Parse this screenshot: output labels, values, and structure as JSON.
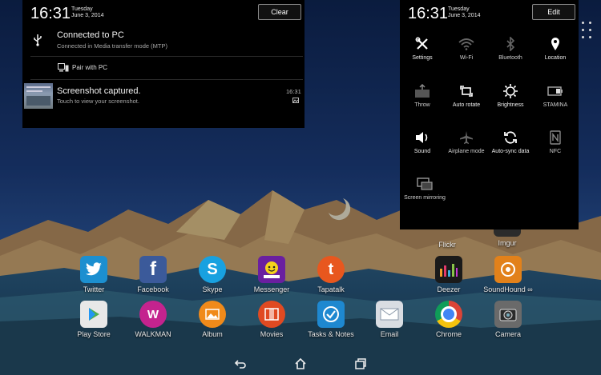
{
  "notification_panel": {
    "time": "16:31",
    "day": "Tuesday",
    "date": "June 3, 2014",
    "clear_label": "Clear",
    "items": [
      {
        "title": "Connected to PC",
        "subtitle": "Connected in Media transfer mode (MTP)",
        "icon": "usb-icon"
      },
      {
        "title": "Pair with PC",
        "icon": "pc-companion-icon"
      },
      {
        "title": "Screenshot captured.",
        "subtitle": "Touch to view your screenshot.",
        "time": "16:31",
        "icon": "screenshot-thumbnail"
      }
    ]
  },
  "quick_settings": {
    "time": "16:31",
    "day": "Tuesday",
    "date": "June 3, 2014",
    "edit_label": "Edit",
    "tiles": [
      {
        "label": "Settings",
        "icon": "settings-tools-icon",
        "active": true
      },
      {
        "label": "Wi-Fi",
        "icon": "wifi-icon",
        "active": false
      },
      {
        "label": "Bluetooth",
        "icon": "bluetooth-icon",
        "active": false
      },
      {
        "label": "Location",
        "icon": "location-pin-icon",
        "active": true
      },
      {
        "label": "Throw",
        "icon": "throw-icon",
        "active": false
      },
      {
        "label": "Auto rotate",
        "icon": "auto-rotate-icon",
        "active": true
      },
      {
        "label": "Brightness",
        "icon": "brightness-icon",
        "active": true
      },
      {
        "label": "STAMINA",
        "icon": "battery-icon",
        "active": false
      },
      {
        "label": "Sound",
        "icon": "sound-icon",
        "active": true
      },
      {
        "label": "Airplane mode",
        "icon": "airplane-icon",
        "active": false
      },
      {
        "label": "Auto-sync data",
        "icon": "sync-icon",
        "active": true
      },
      {
        "label": "NFC",
        "icon": "nfc-icon",
        "active": false
      },
      {
        "label": "Screen mirroring",
        "icon": "screen-mirroring-icon",
        "active": false
      }
    ]
  },
  "home": {
    "apps_partial": [
      {
        "label": "Flickr",
        "icon": "flickr-icon"
      },
      {
        "label": "Imgur",
        "icon": "imgur-icon"
      }
    ],
    "apps_row1": [
      {
        "label": "Twitter",
        "icon": "twitter-icon",
        "color": "#1c8fd0"
      },
      {
        "label": "Facebook",
        "icon": "facebook-icon",
        "color": "#3b5a9a"
      },
      {
        "label": "Skype",
        "icon": "skype-icon",
        "color": "#18a1e0"
      },
      {
        "label": "Messenger",
        "icon": "yahoo-messenger-icon",
        "color": "#6a1fa0"
      },
      {
        "label": "Tapatalk",
        "icon": "tapatalk-icon",
        "color": "#e8571e"
      },
      {
        "label": "Deezer",
        "icon": "deezer-icon",
        "color": "#1a1a1a"
      },
      {
        "label": "SoundHound ∞",
        "icon": "soundhound-icon",
        "color": "#e2811a"
      }
    ],
    "apps_row2": [
      {
        "label": "Play Store",
        "icon": "play-store-icon",
        "color": "#e8e8e8"
      },
      {
        "label": "WALKMAN",
        "icon": "walkman-icon",
        "color": "#c4238e"
      },
      {
        "label": "Album",
        "icon": "album-icon",
        "color": "#f08a1a"
      },
      {
        "label": "Movies",
        "icon": "movies-icon",
        "color": "#e04a22"
      },
      {
        "label": "Tasks & Notes",
        "icon": "tasks-notes-icon",
        "color": "#1e88d0"
      },
      {
        "label": "Email",
        "icon": "email-icon",
        "color": "#d9dde2"
      },
      {
        "label": "Chrome",
        "icon": "chrome-icon",
        "color": "#4285f4"
      },
      {
        "label": "Camera",
        "icon": "camera-icon",
        "color": "#6a6a6a"
      }
    ]
  }
}
